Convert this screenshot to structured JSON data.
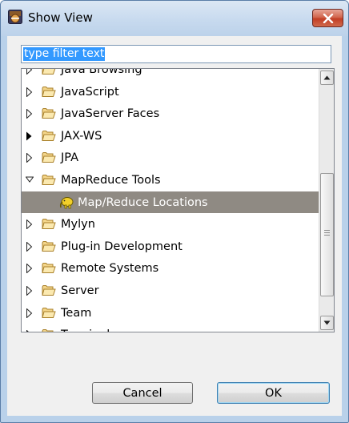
{
  "window": {
    "title": "Show View",
    "close_icon": "close-icon"
  },
  "filter": {
    "value": "type filter text"
  },
  "tree": {
    "items": [
      {
        "label": "Java Browsing",
        "expander": "collapsed",
        "icon": "folder-icon"
      },
      {
        "label": "JavaScript",
        "expander": "collapsed",
        "icon": "folder-icon"
      },
      {
        "label": "JavaServer Faces",
        "expander": "collapsed",
        "icon": "folder-icon"
      },
      {
        "label": "JAX-WS",
        "expander": "collapsed-active",
        "icon": "folder-icon"
      },
      {
        "label": "JPA",
        "expander": "collapsed",
        "icon": "folder-icon"
      },
      {
        "label": "MapReduce Tools",
        "expander": "expanded",
        "icon": "folder-icon"
      },
      {
        "label": "Map/Reduce Locations",
        "expander": "none",
        "icon": "elephant-icon",
        "selected": true
      },
      {
        "label": "Mylyn",
        "expander": "collapsed",
        "icon": "folder-icon"
      },
      {
        "label": "Plug-in Development",
        "expander": "collapsed",
        "icon": "folder-icon"
      },
      {
        "label": "Remote Systems",
        "expander": "collapsed",
        "icon": "folder-icon"
      },
      {
        "label": "Server",
        "expander": "collapsed",
        "icon": "folder-icon"
      },
      {
        "label": "Team",
        "expander": "collapsed",
        "icon": "folder-icon"
      },
      {
        "label": "Terminal",
        "expander": "collapsed",
        "icon": "folder-icon"
      }
    ]
  },
  "buttons": {
    "cancel": "Cancel",
    "ok": "OK"
  }
}
